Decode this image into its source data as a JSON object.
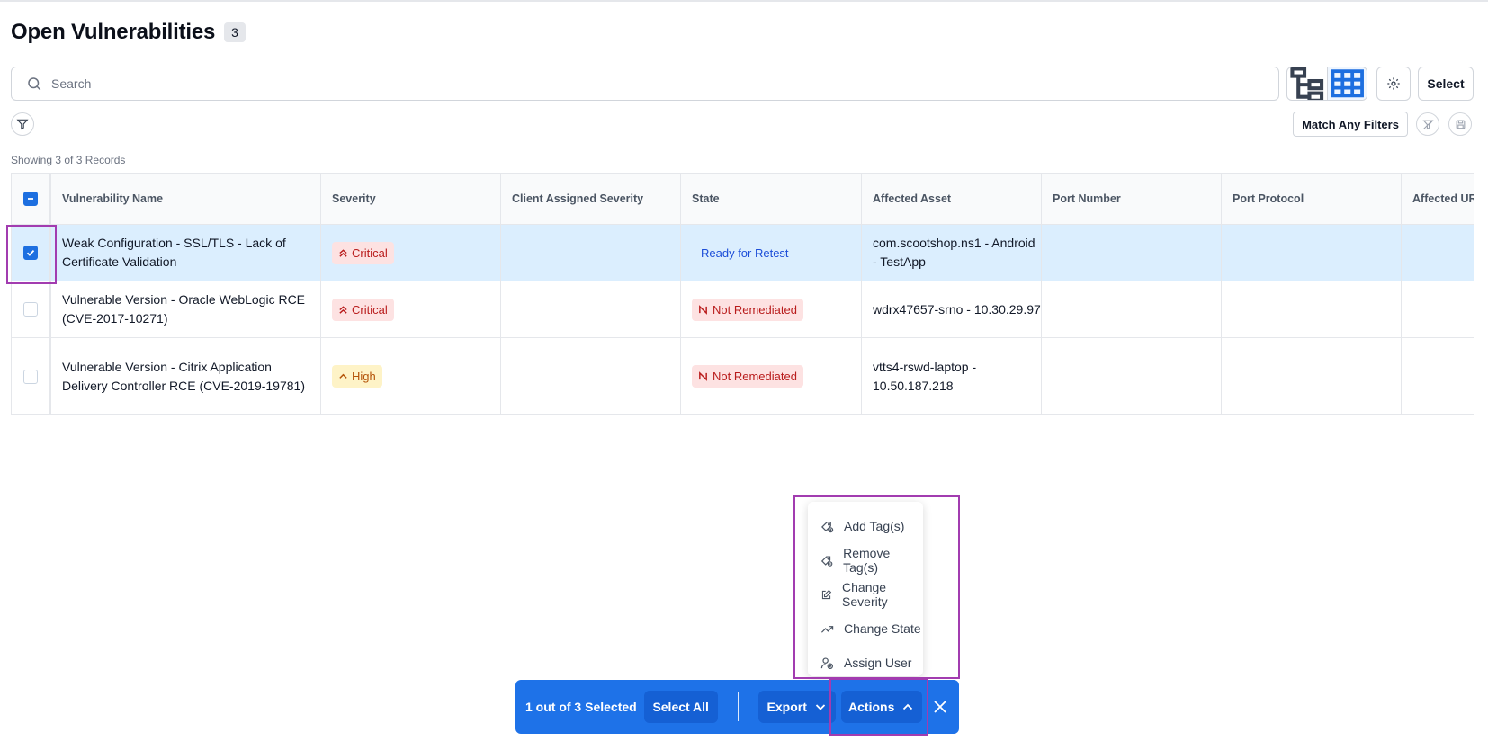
{
  "page": {
    "title": "Open Vulnerabilities",
    "count": "3",
    "showing": "Showing 3 of 3 Records"
  },
  "search": {
    "placeholder": "Search"
  },
  "toolbar": {
    "select_label": "Select",
    "match_filters_label": "Match Any Filters"
  },
  "table": {
    "columns": [
      "Vulnerability Name",
      "Severity",
      "Client Assigned Severity",
      "State",
      "Affected Asset",
      "Port Number",
      "Port Protocol",
      "Affected URL"
    ],
    "rows": [
      {
        "selected": true,
        "name": "Weak Configuration - SSL/TLS - Lack of Certificate Validation",
        "severity": "Critical",
        "client_severity": "",
        "state": "Ready for Retest",
        "asset": "com.scootshop.ns1 - Android - TestApp",
        "port": "",
        "protocol": "",
        "url": ""
      },
      {
        "selected": false,
        "name": "Vulnerable Version - Oracle WebLogic RCE (CVE-2017-10271)",
        "severity": "Critical",
        "client_severity": "",
        "state": "Not Remediated",
        "asset": "wdrx47657-srno - 10.30.29.97",
        "port": "",
        "protocol": "",
        "url": ""
      },
      {
        "selected": false,
        "name": "Vulnerable Version - Citrix Application Delivery Controller RCE (CVE-2019-19781)",
        "severity": "High",
        "client_severity": "",
        "state": "Not Remediated",
        "asset": "vtts4-rswd-laptop - 10.50.187.218",
        "port": "",
        "protocol": "",
        "url": ""
      }
    ]
  },
  "actions_menu": {
    "items": [
      "Add Tag(s)",
      "Remove Tag(s)",
      "Change Severity",
      "Change State",
      "Assign User"
    ]
  },
  "action_bar": {
    "selected_text": "1 out of 3 Selected",
    "select_all": "Select All",
    "export": "Export",
    "actions": "Actions"
  },
  "colors": {
    "primary": "#1e72e8",
    "selected_row": "#dbeefe",
    "critical": "#b91c1c",
    "high": "#b45309",
    "highlight": "#a23cb0"
  }
}
